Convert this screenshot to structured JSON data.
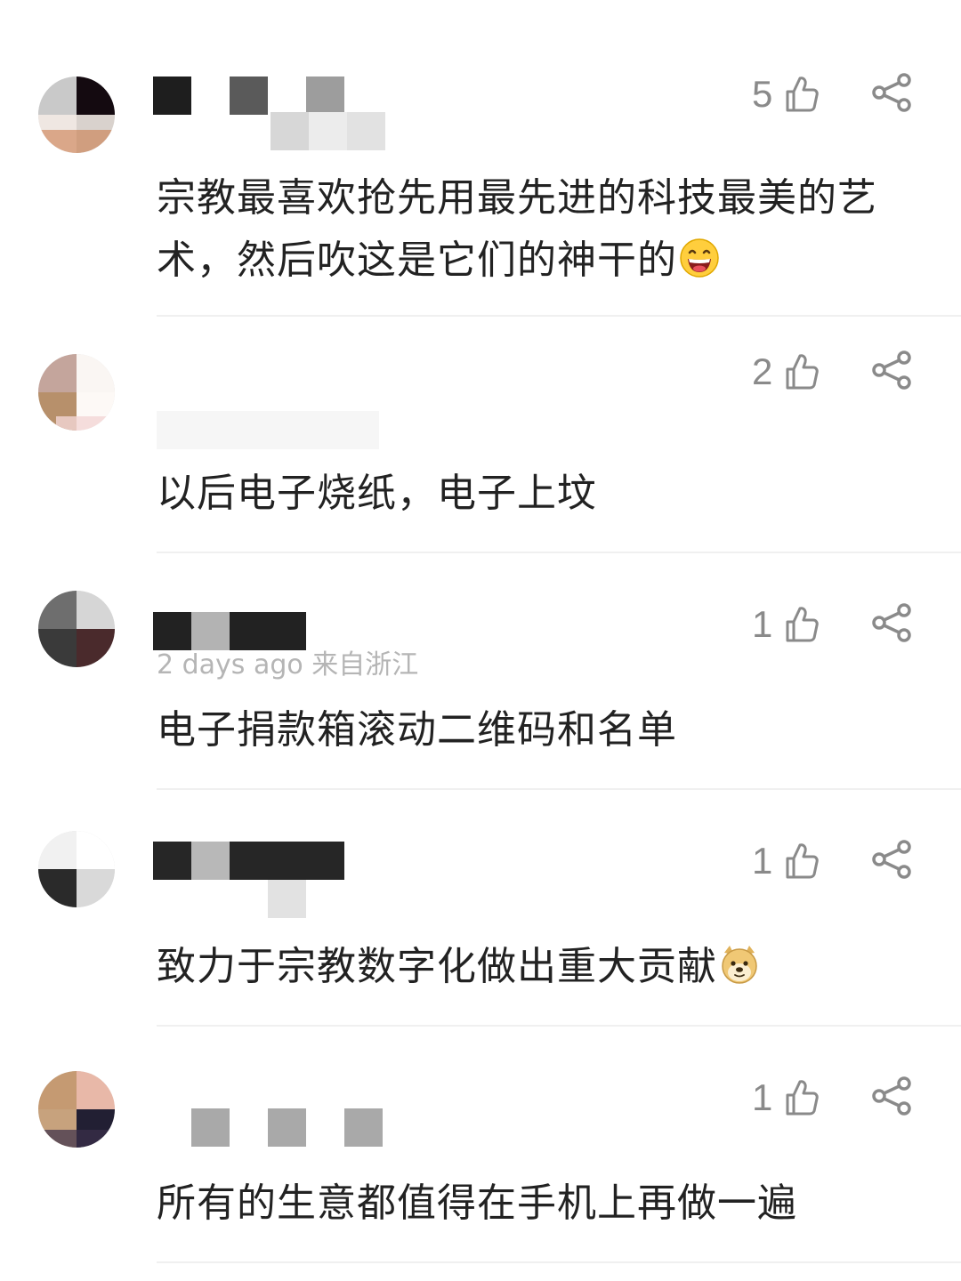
{
  "colors": {
    "text": "#222222",
    "meta": "#b5b5b5",
    "icon": "#8a8a8a",
    "divider": "#f0f0f0"
  },
  "comments": [
    {
      "likes": "5",
      "text": "宗教最喜欢抢先用最先进的科技最美的艺术，然后吹这是它们的神干的",
      "emoji": "grinning-face-icon"
    },
    {
      "likes": "2",
      "text": "以后电子烧纸，电子上坟"
    },
    {
      "likes": "1",
      "meta": "2 days ago  来自浙江",
      "text": "电子捐款箱滚动二维码和名单"
    },
    {
      "likes": "1",
      "text": "致力于宗教数字化做出重大贡献",
      "emoji": "doge-icon"
    },
    {
      "likes": "1",
      "text": "所有的生意都值得在手机上再做一遍"
    }
  ]
}
